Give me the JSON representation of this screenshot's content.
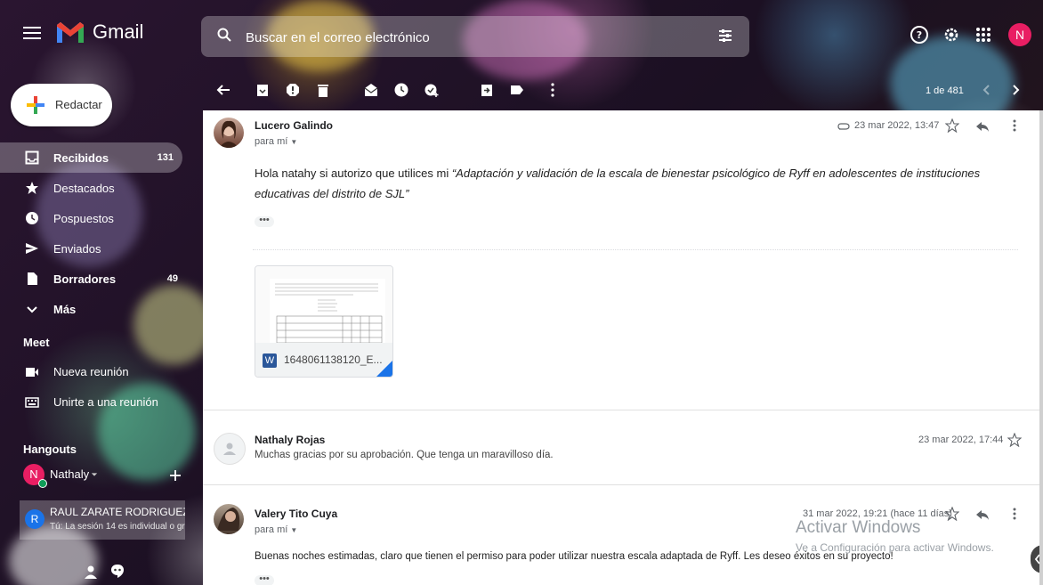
{
  "app": {
    "name": "Gmail"
  },
  "search": {
    "placeholder": "Buscar en el correo electrónico"
  },
  "user": {
    "initial": "N"
  },
  "compose": {
    "label": "Redactar"
  },
  "sidebar": {
    "items": [
      {
        "label": "Recibidos",
        "count": "131",
        "bold": true,
        "icon": "inbox-icon"
      },
      {
        "label": "Destacados",
        "count": "",
        "icon": "star-icon"
      },
      {
        "label": "Pospuestos",
        "count": "",
        "icon": "clock-icon"
      },
      {
        "label": "Enviados",
        "count": "",
        "icon": "send-icon"
      },
      {
        "label": "Borradores",
        "count": "49",
        "bold": true,
        "icon": "draft-icon"
      },
      {
        "label": "Más",
        "count": "",
        "icon": "chevron-down-icon"
      }
    ]
  },
  "meet": {
    "title": "Meet",
    "new_meeting": "Nueva reunión",
    "join_meeting": "Unirte a una reunión"
  },
  "hangouts": {
    "title": "Hangouts",
    "user_name": "Nathaly",
    "user_initial": "N",
    "chat": {
      "initial": "R",
      "name": "RAUL ZARATE RODRIGUEZ",
      "preview": "Tú: La sesión 14 es individual o gr"
    }
  },
  "toolbar": {
    "pager": "1 de 481"
  },
  "messages": [
    {
      "sender": "Lucero Galindo",
      "to": "para mí",
      "date": "23 mar 2022, 13:47",
      "body_prefix": "Hola natahy si autorizo que utilices mi ",
      "body_italic": "“Adaptación y validación de la escala de bienestar psicológico de Ryff en adolescentes de instituciones educativas del distrito de SJL”",
      "attachment": {
        "name": "1648061138120_E..."
      }
    },
    {
      "sender": "Nathaly Rojas",
      "date": "23 mar 2022, 17:44",
      "body": "Muchas gracias por su aprobación. Que tenga un maravilloso día."
    },
    {
      "sender": "Valery Tito Cuya",
      "to": "para mí",
      "date": "31 mar 2022, 19:21 (hace 11 días)",
      "body": "Buenas noches estimadas, claro que tienen el permiso para poder utilizar nuestra escala adaptada de Ryff. Les deseo éxitos en su proyecto!"
    }
  ],
  "watermark": {
    "title": "Activar Windows",
    "subtitle": "Ve a Configuración para activar Windows."
  }
}
